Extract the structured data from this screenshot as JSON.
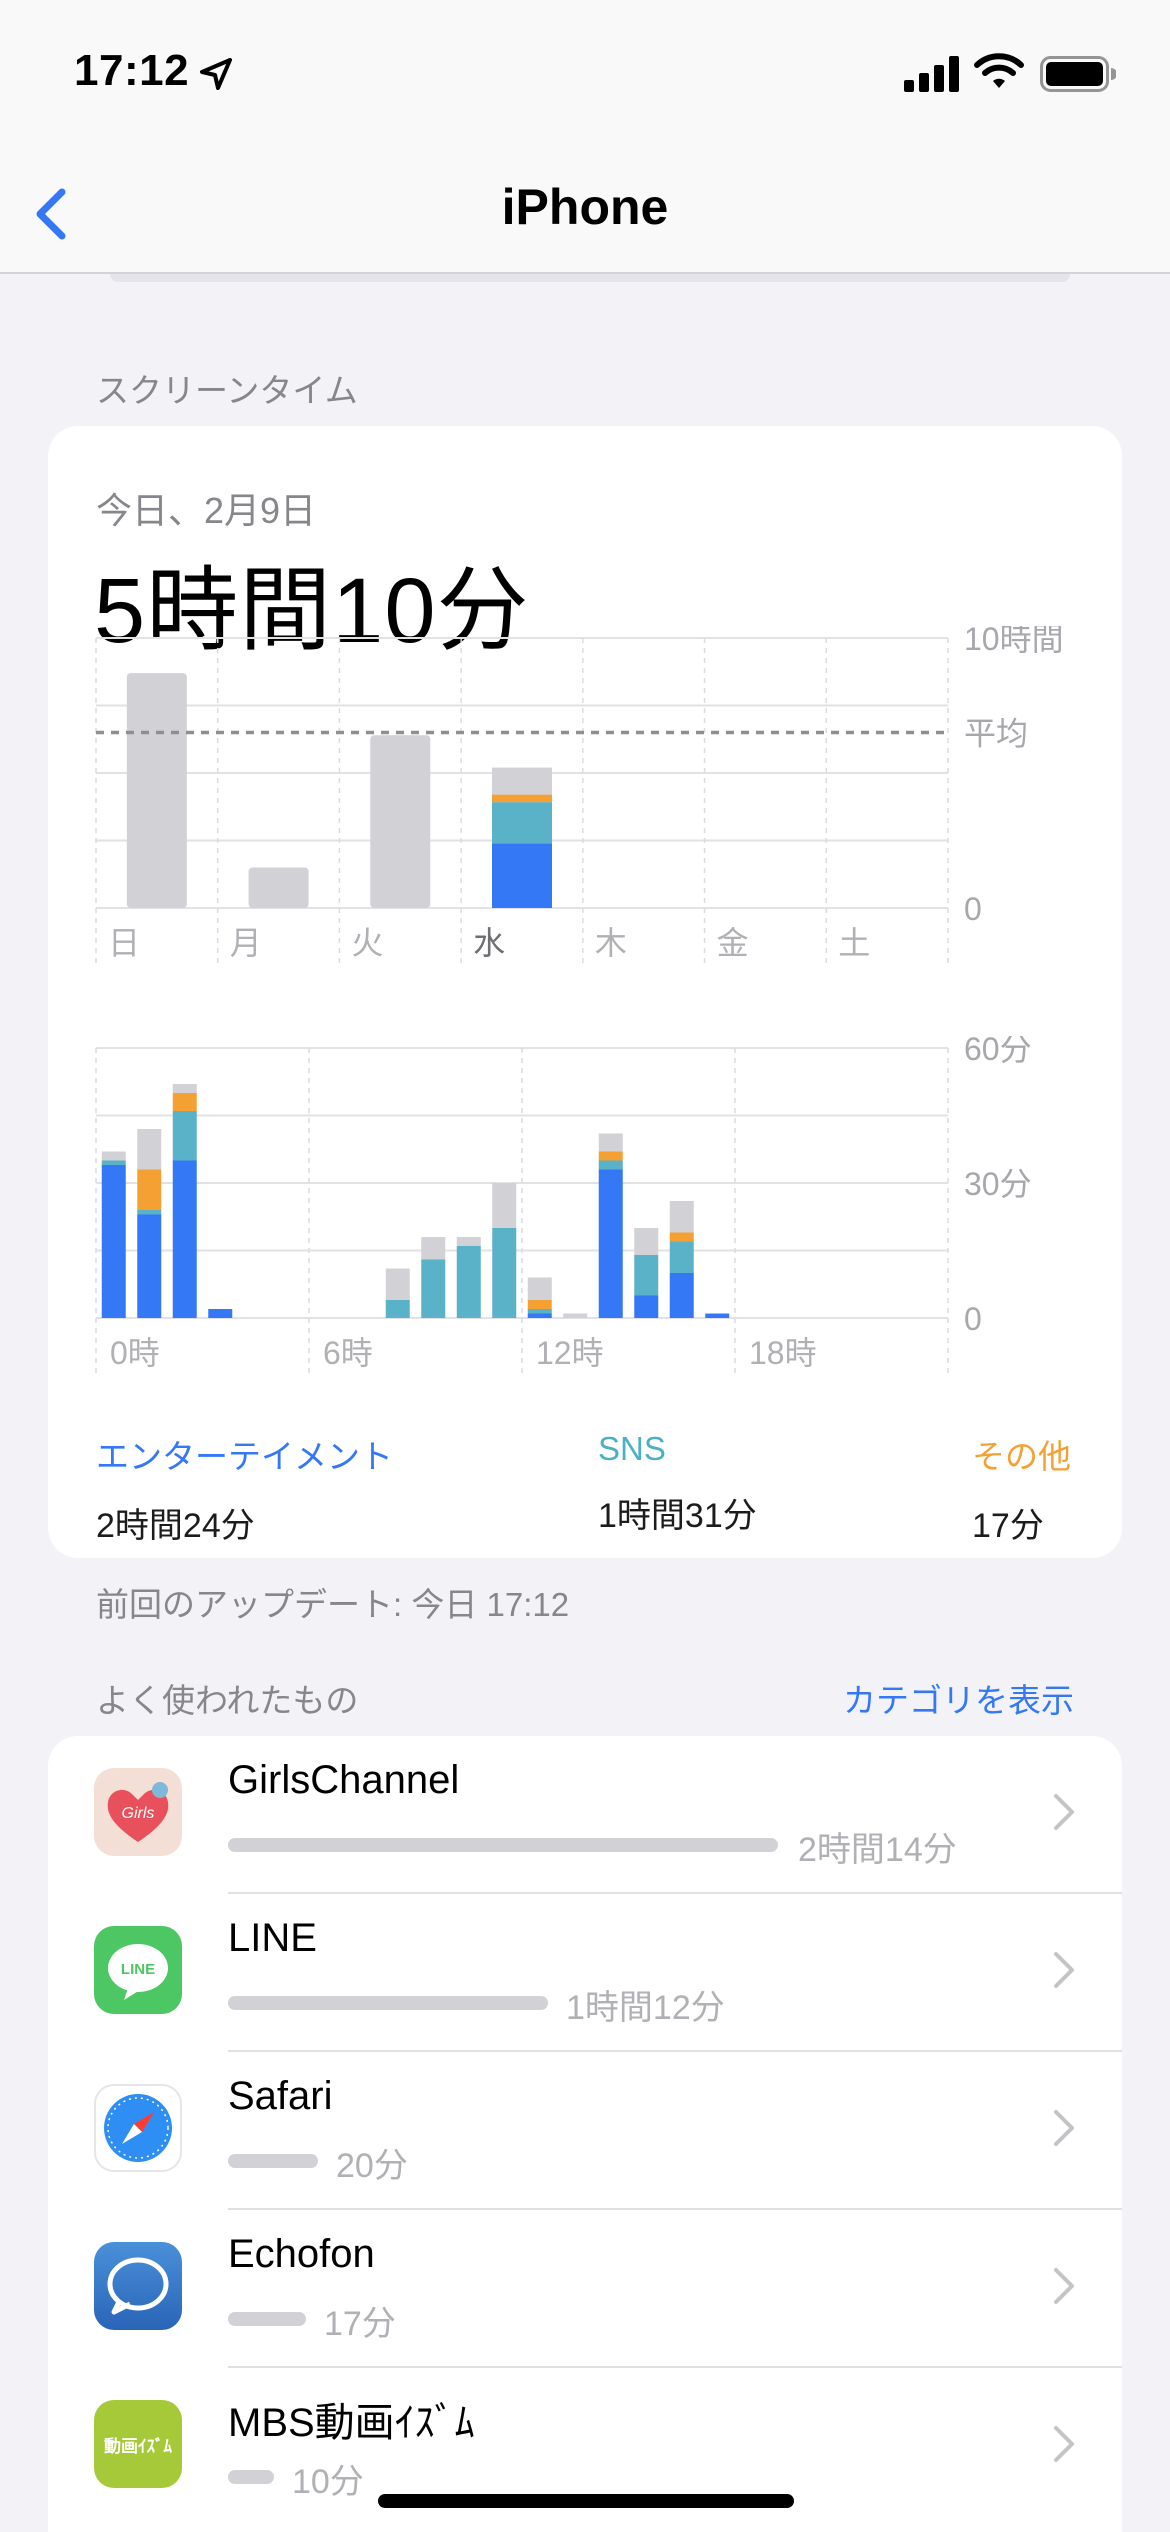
{
  "status_bar": {
    "time": "17:12"
  },
  "nav": {
    "title": "iPhone"
  },
  "screen_time": {
    "section_title": "スクリーンタイム",
    "date_label": "今日、2月9日",
    "total": "5時間10分",
    "weekly_chart": {
      "type": "bar",
      "categories": [
        "日",
        "月",
        "火",
        "水",
        "木",
        "金",
        "土"
      ],
      "today_index": 3,
      "average_label": "平均",
      "average_hours": 6.5,
      "y_ticks": [
        "10時間",
        "0"
      ],
      "y_max_hours": 10,
      "total_hours": [
        8.7,
        1.5,
        6.4,
        5.2,
        0,
        0,
        0
      ],
      "today_breakdown": {
        "entertainment": 2.4,
        "sns": 1.52,
        "other": 0.28,
        "uncategorized": 1.0
      }
    },
    "hourly_chart": {
      "type": "bar",
      "x_tick_labels": [
        "0時",
        "6時",
        "12時",
        "18時"
      ],
      "y_ticks": [
        "60分",
        "30分",
        "0"
      ],
      "y_max_minutes": 60,
      "hours": [
        0,
        1,
        2,
        3,
        4,
        5,
        6,
        7,
        8,
        9,
        10,
        11,
        12,
        13,
        14,
        15,
        16,
        17,
        18,
        19,
        20,
        21,
        22,
        23
      ],
      "series": [
        {
          "name": "エンターテイメント",
          "color": "#3478f6",
          "values": [
            34,
            23,
            35,
            2,
            0,
            0,
            0,
            0,
            0,
            0,
            0,
            0,
            1,
            0,
            33,
            5,
            10,
            1,
            0,
            0,
            0,
            0,
            0,
            0
          ]
        },
        {
          "name": "SNS",
          "color": "#5ab2c8",
          "values": [
            1,
            1,
            11,
            0,
            0,
            0,
            0,
            0,
            4,
            13,
            16,
            20,
            1,
            0,
            2,
            9,
            7,
            0,
            0,
            0,
            0,
            0,
            0,
            0
          ]
        },
        {
          "name": "その他",
          "color": "#f5a033",
          "values": [
            0,
            9,
            4,
            0,
            0,
            0,
            0,
            0,
            0,
            0,
            0,
            0,
            2,
            0,
            2,
            0,
            2,
            0,
            0,
            0,
            0,
            0,
            0,
            0
          ]
        },
        {
          "values": [
            2,
            9,
            2,
            0,
            0,
            0,
            0,
            0,
            7,
            5,
            2,
            10,
            5,
            1,
            4,
            6,
            7,
            0,
            0,
            0,
            0,
            0,
            0,
            0
          ],
          "color": "#d1d1d6"
        }
      ]
    },
    "legend": [
      {
        "name": "エンターテイメント",
        "value": "2時間24分",
        "color": "#3478f6"
      },
      {
        "name": "SNS",
        "value": "1時間31分",
        "color": "#4bb0c4"
      },
      {
        "name": "その他",
        "value": "17分",
        "color": "#f5a033"
      }
    ],
    "last_update": "前回のアップデート: 今日 17:12"
  },
  "most_used": {
    "section_title": "よく使われたもの",
    "show_categories": "カテゴリを表示",
    "apps": [
      {
        "name": "GirlsChannel",
        "time": "2時間14分",
        "minutes": 134,
        "icon": "girlschannel-icon",
        "icon_text": "Girls"
      },
      {
        "name": "LINE",
        "time": "1時間12分",
        "minutes": 72,
        "icon": "line-icon",
        "icon_text": "LINE"
      },
      {
        "name": "Safari",
        "time": "20分",
        "minutes": 20,
        "icon": "safari-icon"
      },
      {
        "name": "Echofon",
        "time": "17分",
        "minutes": 17,
        "icon": "echofon-icon"
      },
      {
        "name": "MBS動画ｲｽﾞﾑ",
        "time": "10分",
        "minutes": 10,
        "icon": "mbs-icon",
        "icon_text": "動画ｲｽﾞﾑ"
      }
    ]
  }
}
